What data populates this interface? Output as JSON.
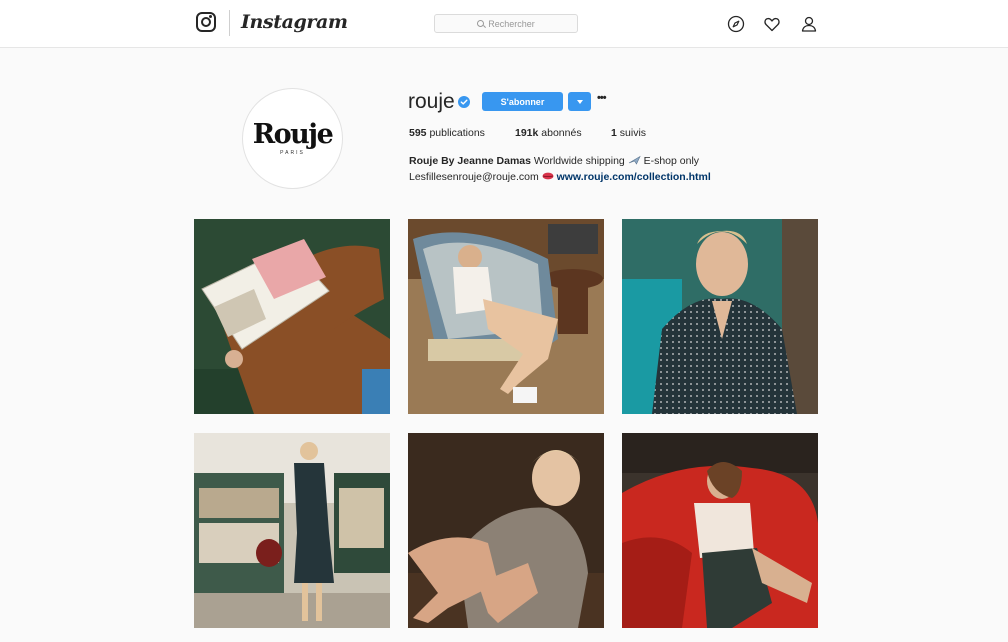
{
  "header": {
    "wordmark": "Instagram",
    "search_placeholder": "Rechercher"
  },
  "profile": {
    "avatar_brand": "Rouje",
    "avatar_sub": "PARIS",
    "username": "rouje",
    "follow_label": "S'abonner",
    "stats": {
      "posts_count": "595",
      "posts_label": "publications",
      "followers_count": "191k",
      "followers_label": "abonnés",
      "following_count": "1",
      "following_label": "suivis"
    },
    "bio": {
      "name": "Rouje By Jeanne Damas",
      "text1": "Worldwide shipping",
      "text2": "E-shop only",
      "email": "Lesfillesenrouje@rouje.com",
      "link": "www.rouje.com/collection.html"
    }
  },
  "colors": {
    "accent": "#3897f0",
    "link": "#003569",
    "background": "#fafafa"
  },
  "icons": [
    "instagram-logo-icon",
    "search-icon",
    "compass-icon",
    "heart-icon",
    "user-icon",
    "verified-badge-icon",
    "chevron-down-icon",
    "more-options-icon",
    "airplane-emoji",
    "lips-emoji"
  ]
}
